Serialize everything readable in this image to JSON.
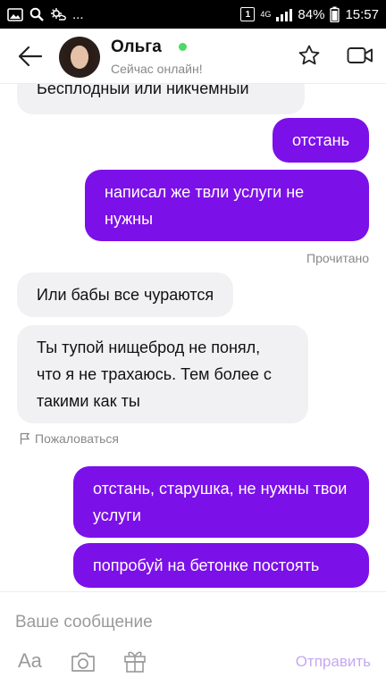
{
  "status_bar": {
    "battery_percent": "84%",
    "time": "15:57",
    "sim_badge": "1",
    "network": "4G",
    "overflow": "..."
  },
  "header": {
    "name": "Ольга",
    "status": "Сейчас онлайн!",
    "online_color": "#4cd964"
  },
  "messages": [
    {
      "direction": "in",
      "text": "Бесплодный или никчемный"
    },
    {
      "direction": "out",
      "text": "отстань"
    },
    {
      "direction": "out",
      "text": "написал же твли услуги не нужны"
    },
    {
      "direction": "out_meta",
      "text": "Прочитано"
    },
    {
      "direction": "in",
      "text": "Или бабы все чураются"
    },
    {
      "direction": "in",
      "text": "Ты тупой нищеброд не понял, что я не трахаюсь. Тем более с такими как ты"
    },
    {
      "direction": "in_meta",
      "text": "Пожаловаться"
    },
    {
      "direction": "out",
      "text": "отстань, старушка, не нужны твои услуги"
    },
    {
      "direction": "out",
      "text": "попробуй на бетонке постоять"
    }
  ],
  "composer": {
    "placeholder": "Ваше сообщение",
    "format_label": "Aa",
    "send_label": "Отправить"
  },
  "colors": {
    "outgoing_bubble": "#7c10e8",
    "incoming_bubble": "#f1f1f3",
    "send_disabled": "#c5a9f0"
  },
  "icons": [
    "back-arrow-icon",
    "star-icon",
    "video-call-icon",
    "flag-icon",
    "camera-icon",
    "gift-icon"
  ]
}
